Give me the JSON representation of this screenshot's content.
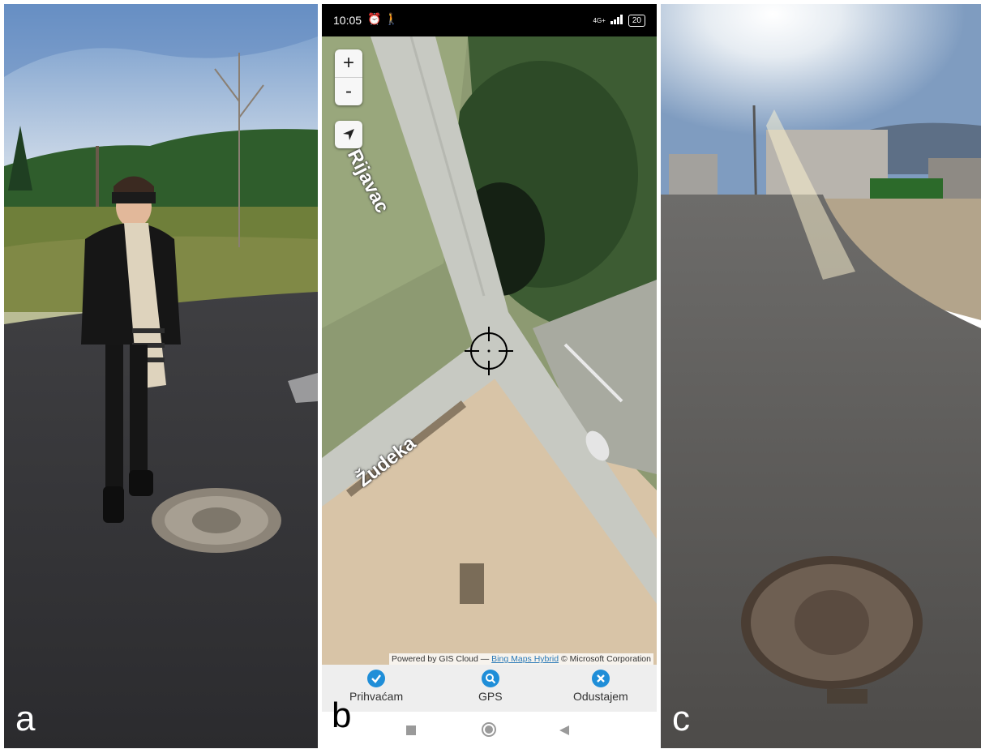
{
  "panels": {
    "a": {
      "letter": "a"
    },
    "b": {
      "letter": "b"
    },
    "c": {
      "letter": "c"
    }
  },
  "phone": {
    "status_time": "10:05",
    "network": "4G+",
    "battery": "20"
  },
  "map": {
    "zoom_in_label": "+",
    "zoom_out_label": "-",
    "streets": [
      "Rijavac",
      "Žudeka"
    ],
    "attribution": {
      "prefix": "Powered by GIS Cloud — ",
      "link": "Bing Maps Hybrid",
      "suffix": " © Microsoft Corporation"
    }
  },
  "actions": {
    "accept": "Prihvaćam",
    "gps": "GPS",
    "cancel": "Odustajem"
  },
  "colors": {
    "action_blue": "#1f8ed8",
    "status_bar": "#000000"
  }
}
